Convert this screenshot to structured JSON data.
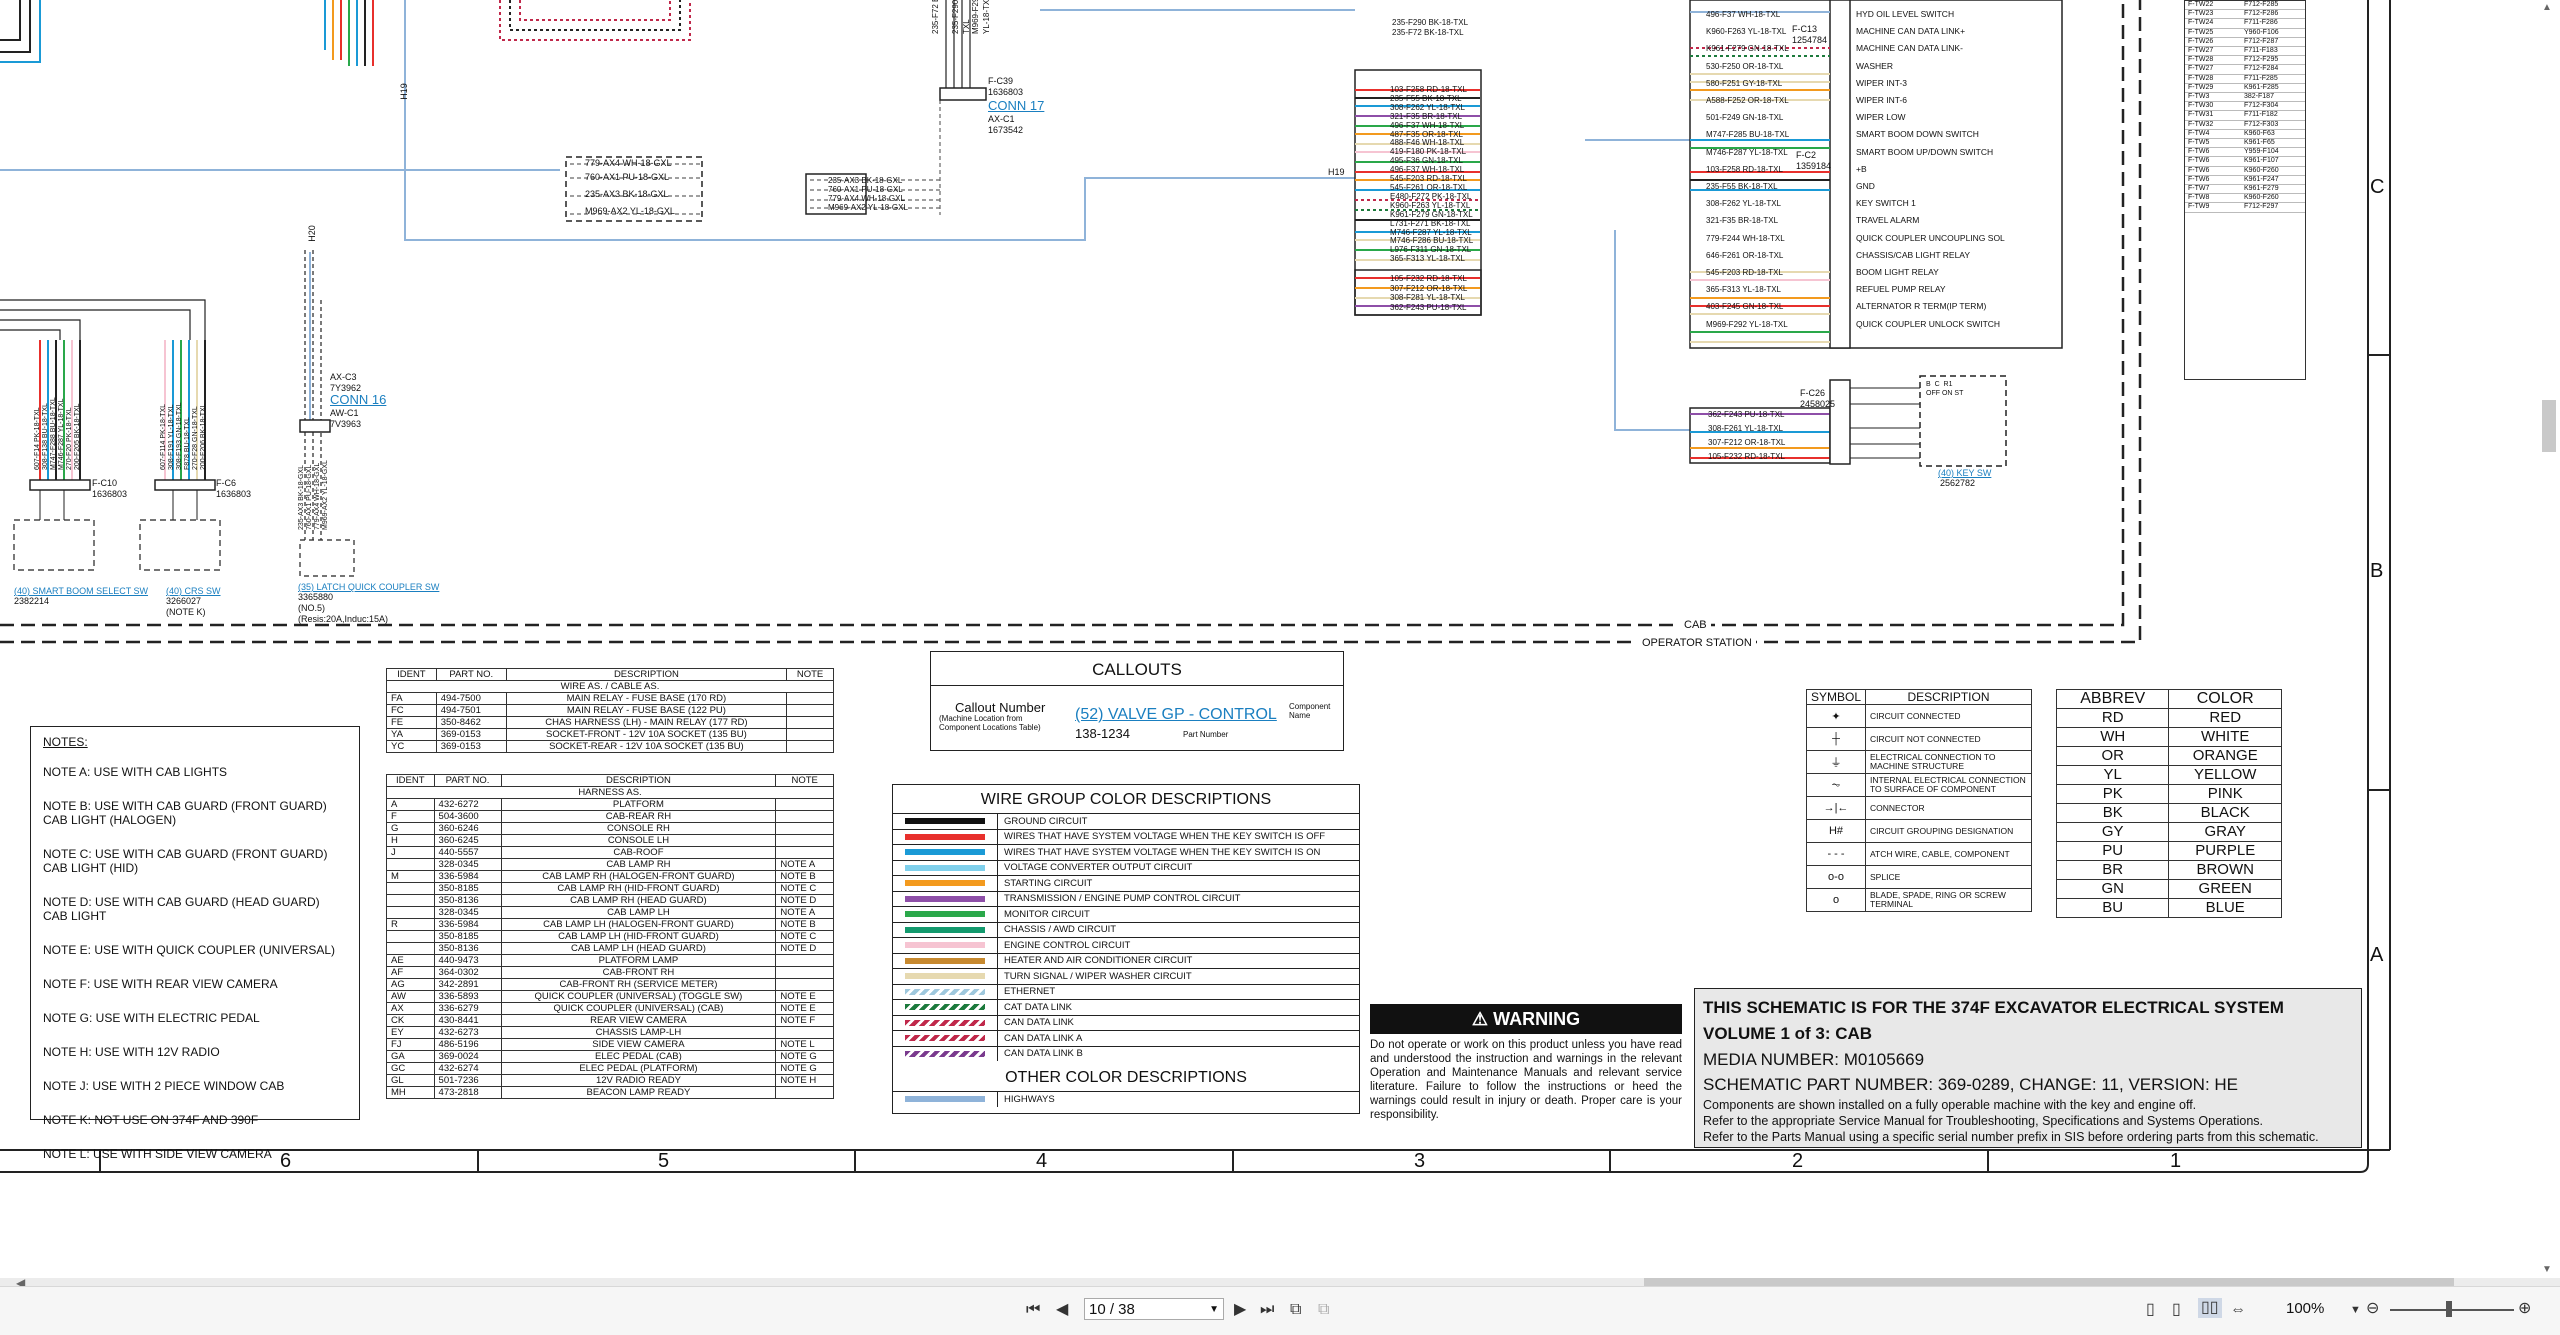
{
  "connectors": {
    "conn17": {
      "name": "CONN 17",
      "code": "F-C39",
      "part": "1636803",
      "sub": "AX-C1",
      "sub_part": "1673542"
    },
    "conn16": {
      "name": "CONN 16",
      "code": "AX-C3",
      "part": "7Y3962",
      "sub": "AW-C1",
      "sub_part": "7V3963"
    },
    "c10": {
      "code": "F-C10",
      "part": "1636803"
    },
    "c6": {
      "code": "F-C6",
      "part": "1636803"
    },
    "c26": {
      "code": "F-C26",
      "part": "2458025"
    }
  },
  "wire_tags": {
    "h19": "H19",
    "h20": "H20",
    "mid_left": [
      "779-AX4 WH-18-GXL",
      "760-AX1 PU-18-GXL",
      "235-AX3 BK-18-GXL",
      "M969-AX2 YL-18-GXL"
    ],
    "mid_right": [
      "235-AX3 BK-18-GXL",
      "760-AX1 PU-18-GXL",
      "779-AX4 WH-18-GXL",
      "M969-AX2 YL-18-GXL"
    ],
    "conn17_top": [
      "235-F72 BK-18-TXL",
      "235-F290 BK-18-TXL",
      "M969-F292 YL-18-TXL"
    ],
    "center_top": [
      "235-F290 BK-18-TXL",
      "235-F72 BK-18-TXL"
    ],
    "center_block": [
      "103-F258 RD-18-TXL",
      "235-F55 BK-18-TXL",
      "308-F262 YL-18-TXL",
      "321-F35 BR-18-TXL",
      "496-F37 WH-18-TXL",
      "487-F35 OR-18-TXL",
      "488-F46 WH-18-TXL",
      "419-F180 PK-18-TXL",
      "495-F36 GN-18-TXL",
      "496-F37 WH-18-TXL",
      "545-F203 RD-18-TXL",
      "545-F261 OR-18-TXL",
      "E480-F272 PK-18-TXL",
      "K960-F263 YL-18-TXL",
      "K961-F279 GN-18-TXL",
      "L731-F271 BK-18-TXL",
      "M746-F287 YL-18-TXL",
      "M746-F286 BU-18-TXL",
      "L976-F311 GN-18-TXL",
      "365-F313 YL-18-TXL"
    ],
    "center_block2": [
      "105-F232 RD-18-TXL",
      "307-F212 OR-18-TXL",
      "308-F281 YL-18-TXL",
      "362-F243 PU-18-TXL"
    ],
    "right_switches": [
      "496-F37 WH-18-TXL",
      "K960-F263 YL-18-TXL",
      "K961-F279 GN-18-TXL",
      "530-F250 OR-18-TXL",
      "580-F251 GY-18-TXL",
      "A588-F252 OR-18-TXL",
      "501-F249 GN-18-TXL",
      "M747-F285 BU-18-TXL",
      "M746-F287 YL-18-TXL",
      "103-F258 RD-18-TXL",
      "235-F55 BK-18-TXL",
      "308-F262 YL-18-TXL",
      "321-F35 BR-18-TXL",
      "779-F244 WH-18-TXL",
      "646-F261 OR-18-TXL",
      "545-F203 RD-18-TXL",
      "365-F313 YL-18-TXL",
      "403-F245 GN-18-TXL",
      "M969-F292 YL-18-TXL"
    ],
    "key_sw_wires": [
      "362-F243 PU-18-TXL",
      "308-F261 YL-18-TXL",
      "307-F212 OR-18-TXL",
      "105-F232 RD-18-TXL"
    ],
    "left_vertical_a": [
      "607-F14 PK-18-TXL",
      "308-F138 BU-18-TXL",
      "M747-F288 BU-18-TXL",
      "M746-F287 YL-18-TXL",
      "270-F20 PK-18-TXL",
      "200-F205 BK-18-TXL"
    ],
    "left_vertical_b": [
      "607-F114 PK-18-TXL",
      "308-F191 YL-18-TXL",
      "308-F193 GN-18-TXL",
      "F878 BU-18-TXL",
      "270-F28 GN-18-TXL",
      "200-F206 BK-18-TXL"
    ],
    "conn16_vertical": [
      "235-AX3 BK-18-GXL",
      "760-AX1 PU-18-GXL",
      "779-AX4 WH-18-GXL",
      "M969-AX2 YL-18-GXL"
    ]
  },
  "switch_labels": {
    "right": [
      "HYD OIL LEVEL SWITCH",
      "MACHINE CAN DATA LINK+",
      "MACHINE CAN DATA LINK-",
      "WASHER",
      "WIPER INT-3",
      "WIPER INT-6",
      "WIPER LOW",
      "SMART BOOM DOWN SWITCH",
      "SMART BOOM UP/DOWN SWITCH",
      "+B",
      "GND",
      "KEY SWITCH 1",
      "TRAVEL ALARM",
      "QUICK COUPLER UNCOUPLING SOL",
      "CHASSIS/CAB LIGHT RELAY",
      "BOOM LIGHT RELAY",
      "REFUEL PUMP RELAY",
      "ALTERNATOR R TERM(IP TERM)",
      "QUICK COUPLER UNLOCK SWITCH"
    ],
    "key_sw": {
      "name": "(40) KEY SW",
      "part": "2562782"
    },
    "smart_boom": {
      "name": "(40) SMART BOOM SELECT SW",
      "part": "2382214"
    },
    "crs_sw": {
      "name": "(40) CRS SW",
      "part": "3266027",
      "note": "(NOTE K)"
    },
    "quick_coupler": {
      "name": "(35) LATCH QUICK COUPLER SW",
      "part": "3365880",
      "note": "(NO.5)",
      "rating": "(Resis:20A,Induc:15A)"
    },
    "key_terms": [
      "B",
      "C",
      "R1",
      "OFF",
      "ON",
      "ST"
    ]
  },
  "fc13": {
    "code": "F-C13",
    "part": "1254784"
  },
  "fc2": {
    "code": "F-C2",
    "part": "1359184"
  },
  "zone_labels": {
    "cab": "CAB",
    "operator": "OPERATOR STATION"
  },
  "side_rows": [
    "C",
    "B",
    "A"
  ],
  "bottom_cols": [
    "6",
    "5",
    "4",
    "3",
    "2",
    "1"
  ],
  "abbrev_list": [
    [
      "F-TW22",
      "F712-F285"
    ],
    [
      "F-TW23",
      "F712-F286"
    ],
    [
      "F-TW24",
      "F711-F286"
    ],
    [
      "F-TW25",
      "Y960-F106"
    ],
    [
      "F-TW26",
      "F712-F287"
    ],
    [
      "F-TW27",
      "F711-F183"
    ],
    [
      "F-TW28",
      "F712-F295"
    ],
    [
      "F-TW27",
      "F712-F284"
    ],
    [
      "F-TW28",
      "F711-F285"
    ],
    [
      "F-TW29",
      "K961-F285"
    ],
    [
      "F-TW3",
      "382-F187"
    ],
    [
      "F-TW30",
      "F712-F304"
    ],
    [
      "F-TW31",
      "F711-F182"
    ],
    [
      "F-TW32",
      "F712-F303"
    ],
    [
      "F-TW4",
      "K960-F63"
    ],
    [
      "F-TW5",
      "K961-F65"
    ],
    [
      "F-TW6",
      "Y959-F104"
    ],
    [
      "F-TW6",
      "K961-F107"
    ],
    [
      "F-TW6",
      "K960-F260"
    ],
    [
      "F-TW6",
      "K961-F247"
    ],
    [
      "F-TW7",
      "K961-F279"
    ],
    [
      "F-TW8",
      "K960-F260"
    ],
    [
      "F-TW9",
      "F712-F297"
    ]
  ],
  "ident_table1": {
    "headers": [
      "IDENT",
      "PART NO.",
      "DESCRIPTION",
      "NOTE"
    ],
    "group": "WIRE AS. / CABLE AS.",
    "rows": [
      [
        "FA",
        "494-7500",
        "MAIN RELAY - FUSE BASE (170 RD)",
        ""
      ],
      [
        "FC",
        "494-7501",
        "MAIN RELAY - FUSE BASE (122 PU)",
        ""
      ],
      [
        "FE",
        "350-8462",
        "CHAS HARNESS (LH) - MAIN RELAY (177 RD)",
        ""
      ],
      [
        "YA",
        "369-0153",
        "SOCKET-FRONT - 12V 10A SOCKET (135 BU)",
        ""
      ],
      [
        "YC",
        "369-0153",
        "SOCKET-REAR - 12V 10A SOCKET (135 BU)",
        ""
      ]
    ]
  },
  "ident_table2": {
    "headers": [
      "IDENT",
      "PART NO.",
      "DESCRIPTION",
      "NOTE"
    ],
    "group": "HARNESS AS.",
    "rows": [
      [
        "A",
        "432-6272",
        "PLATFORM",
        ""
      ],
      [
        "F",
        "504-3600",
        "CAB-REAR RH",
        ""
      ],
      [
        "G",
        "360-6246",
        "CONSOLE RH",
        ""
      ],
      [
        "H",
        "360-6245",
        "CONSOLE LH",
        ""
      ],
      [
        "J",
        "440-5557",
        "CAB-ROOF",
        ""
      ],
      [
        "",
        "328-0345",
        "CAB LAMP RH",
        "NOTE A"
      ],
      [
        "M",
        "336-5984",
        "CAB LAMP RH (HALOGEN-FRONT GUARD)",
        "NOTE B"
      ],
      [
        "",
        "350-8185",
        "CAB LAMP RH (HID-FRONT GUARD)",
        "NOTE C"
      ],
      [
        "",
        "350-8136",
        "CAB LAMP RH (HEAD GUARD)",
        "NOTE D"
      ],
      [
        "",
        "328-0345",
        "CAB LAMP LH",
        "NOTE A"
      ],
      [
        "R",
        "336-5984",
        "CAB LAMP LH (HALOGEN-FRONT GUARD)",
        "NOTE B"
      ],
      [
        "",
        "350-8185",
        "CAB LAMP LH (HID-FRONT GUARD)",
        "NOTE C"
      ],
      [
        "",
        "350-8136",
        "CAB LAMP LH (HEAD GUARD)",
        "NOTE D"
      ],
      [
        "AE",
        "440-9473",
        "PLATFORM LAMP",
        ""
      ],
      [
        "AF",
        "364-0302",
        "CAB-FRONT RH",
        ""
      ],
      [
        "AG",
        "342-2891",
        "CAB-FRONT RH (SERVICE METER)",
        ""
      ],
      [
        "AW",
        "336-5893",
        "QUICK COUPLER (UNIVERSAL) (TOGGLE SW)",
        "NOTE E"
      ],
      [
        "AX",
        "336-6279",
        "QUICK COUPLER (UNIVERSAL) (CAB)",
        "NOTE E"
      ],
      [
        "CK",
        "430-8441",
        "REAR VIEW CAMERA",
        "NOTE F"
      ],
      [
        "EY",
        "432-6273",
        "CHASSIS LAMP-LH",
        ""
      ],
      [
        "FJ",
        "486-5196",
        "SIDE VIEW CAMERA",
        "NOTE L"
      ],
      [
        "GA",
        "369-0024",
        "ELEC PEDAL (CAB)",
        "NOTE G"
      ],
      [
        "GC",
        "432-6274",
        "ELEC PEDAL (PLATFORM)",
        "NOTE G"
      ],
      [
        "GL",
        "501-7236",
        "12V RADIO READY",
        "NOTE H"
      ],
      [
        "MH",
        "473-2818",
        "BEACON LAMP READY",
        ""
      ]
    ]
  },
  "notes": {
    "title": "NOTES:",
    "items": [
      "NOTE A: USE WITH CAB LIGHTS",
      "NOTE B: USE WITH CAB GUARD (FRONT GUARD) CAB LIGHT (HALOGEN)",
      "NOTE C: USE WITH CAB GUARD (FRONT GUARD) CAB LIGHT (HID)",
      "NOTE D: USE WITH CAB GUARD (HEAD GUARD) CAB LIGHT",
      "NOTE E: USE WITH QUICK COUPLER (UNIVERSAL)",
      "NOTE F: USE WITH REAR VIEW CAMERA",
      "NOTE G: USE WITH ELECTRIC PEDAL",
      "NOTE H: USE WITH 12V RADIO",
      "NOTE J: USE WITH 2 PIECE WINDOW CAB",
      "NOTE K: NOT USE ON 374F AND 390F",
      "NOTE L: USE WITH SIDE VIEW CAMERA"
    ]
  },
  "callouts": {
    "title": "CALLOUTS",
    "callout_number": "Callout Number",
    "callout_sub": "(Machine Location from Component Locations Table)",
    "example": "(52) VALVE GP - CONTROL",
    "part": "138-1234",
    "part_label": "Part Number",
    "component_name": "Component Name"
  },
  "wire_group": {
    "title": "WIRE GROUP COLOR DESCRIPTIONS",
    "rows": [
      {
        "color": "#111111",
        "label": "GROUND CIRCUIT"
      },
      {
        "color": "#e8302c",
        "label": "WIRES THAT HAVE SYSTEM VOLTAGE WHEN THE KEY SWITCH IS OFF"
      },
      {
        "color": "#1a9ad6",
        "label": "WIRES THAT HAVE SYSTEM VOLTAGE WHEN THE KEY SWITCH IS ON"
      },
      {
        "color": "#7fd0ec",
        "label": "VOLTAGE CONVERTER OUTPUT CIRCUIT"
      },
      {
        "color": "#f39a1e",
        "label": "STARTING CIRCUIT"
      },
      {
        "color": "#8e4fa8",
        "label": "TRANSMISSION / ENGINE PUMP CONTROL CIRCUIT"
      },
      {
        "color": "#2aa84a",
        "label": "MONITOR CIRCUIT"
      },
      {
        "color": "#139a6e",
        "label": "CHASSIS / AWD CIRCUIT"
      },
      {
        "color": "#f6c4d2",
        "label": "ENGINE CONTROL CIRCUIT"
      },
      {
        "color": "#c7892f",
        "label": "HEATER AND AIR CONDITIONER CIRCUIT"
      },
      {
        "color": "#e6d9b0",
        "label": "TURN SIGNAL / WIPER WASHER CIRCUIT"
      },
      {
        "color": "#9fc8dd",
        "label": "ETHERNET",
        "hatch": true
      },
      {
        "color": "#1c7a3c",
        "label": "CAT DATA LINK",
        "hatch": true
      },
      {
        "color": "#c0284a",
        "label": "CAN DATA LINK",
        "hatch": true
      },
      {
        "color": "#c0284a",
        "label": "CAN DATA LINK A",
        "hatch": true
      },
      {
        "color": "#7a3a8e",
        "label": "CAN DATA LINK B",
        "hatch": true
      }
    ],
    "other_title": "OTHER COLOR DESCRIPTIONS",
    "other_rows": [
      {
        "color": "#8fb3d9",
        "label": "HIGHWAYS"
      }
    ]
  },
  "warning": {
    "title": "WARNING",
    "text": "Do not operate or work on this product unless you have read and understood the instruction and warnings in the relevant Operation and Maintenance Manuals and relevant service literature. Failure to follow the instructions or heed the warnings could result in injury or death. Proper care is your responsibility."
  },
  "symbol_table": {
    "headers": [
      "SYMBOL",
      "DESCRIPTION"
    ],
    "rows": [
      {
        "sym": "✦",
        "desc": "CIRCUIT CONNECTED"
      },
      {
        "sym": "┼",
        "desc": "CIRCUIT NOT CONNECTED"
      },
      {
        "sym": "⏚",
        "desc": "ELECTRICAL CONNECTION TO MACHINE STRUCTURE"
      },
      {
        "sym": "⏦",
        "desc": "INTERNAL ELECTRICAL CONNECTION TO SURFACE OF COMPONENT"
      },
      {
        "sym": "→|←",
        "desc": "CONNECTOR"
      },
      {
        "sym": "H#",
        "desc": "CIRCUIT GROUPING DESIGNATION"
      },
      {
        "sym": "- - -",
        "desc": "ATCH WIRE, CABLE, COMPONENT"
      },
      {
        "sym": "o-o",
        "desc": "SPLICE"
      },
      {
        "sym": "o",
        "desc": "BLADE, SPADE, RING OR SCREW TERMINAL"
      }
    ]
  },
  "abbrev_table": {
    "headers": [
      "ABBREV",
      "COLOR"
    ],
    "rows": [
      [
        "RD",
        "RED"
      ],
      [
        "WH",
        "WHITE"
      ],
      [
        "OR",
        "ORANGE"
      ],
      [
        "YL",
        "YELLOW"
      ],
      [
        "PK",
        "PINK"
      ],
      [
        "BK",
        "BLACK"
      ],
      [
        "GY",
        "GRAY"
      ],
      [
        "PU",
        "PURPLE"
      ],
      [
        "BR",
        "BROWN"
      ],
      [
        "GN",
        "GREEN"
      ],
      [
        "BU",
        "BLUE"
      ]
    ]
  },
  "title_block": {
    "line1": "THIS SCHEMATIC IS FOR THE 374F EXCAVATOR ELECTRICAL SYSTEM",
    "line2": "VOLUME 1 of 3: CAB",
    "line3": "MEDIA NUMBER: M0105669",
    "line4": "SCHEMATIC PART NUMBER: 369-0289, CHANGE: 11, VERSION: HE",
    "line5": "Components are shown installed on a fully operable machine with the key and engine off.",
    "line6": "Refer to the appropriate Service Manual for Troubleshooting, Specifications and Systems Operations.",
    "line7": "Refer to the Parts Manual using a specific serial number prefix in SIS before ordering parts from this schematic."
  },
  "viewer": {
    "page_value": "10 / 38",
    "zoom": "100%"
  }
}
